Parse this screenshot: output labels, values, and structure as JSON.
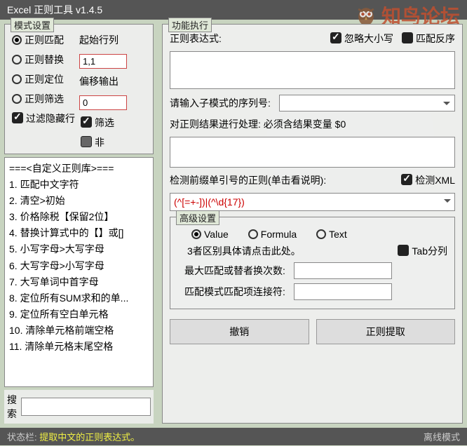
{
  "title": "Excel 正则工具 v1.4.5",
  "watermark": "知鸟论坛",
  "modeGroup": {
    "title": "模式设置",
    "radios": [
      "正则匹配",
      "正则替换",
      "正则定位",
      "正则筛选"
    ],
    "selected": 0,
    "hideRow": "过滤隐藏行",
    "startLabel": "起始行列",
    "startValue": "1,1",
    "offsetLabel": "偏移输出",
    "offsetValue": "0",
    "filter": "筛选",
    "not": "非"
  },
  "library": {
    "header": "===<自定义正则库>===",
    "items": [
      "1. 匹配中文字符",
      "2. 清空>初始",
      "3. 价格除税【保留2位】",
      "4. 替换计算式中的【】或[]",
      "5. 小写字母>大写字母",
      "6. 大写字母>小写字母",
      "7. 大写单词中首字母",
      "8. 定位所有SUM求和的单...",
      "9. 定位所有空白单元格",
      "10. 清除单元格前端空格",
      "11. 清除单元格末尾空格"
    ]
  },
  "searchLabel": "搜索",
  "exec": {
    "title": "功能执行",
    "exprLabel": "正则表达式:",
    "ignoreCase": "忽略大小写",
    "reverse": "匹配反序",
    "subLabel": "请输入子模式的序列号:",
    "procLabel": "对正则结果进行处理:  必须含结果变量 $0",
    "prefixLabel": "检测前缀单引号的正则(单击看说明):",
    "xmlLabel": "检测XML",
    "prefixValue": "(^[=+-])|(^\\d{17})"
  },
  "adv": {
    "title": "高级设置",
    "radios": [
      "Value",
      "Formula",
      "Text"
    ],
    "selected": 0,
    "hint": "3者区别具体请点击此处。",
    "tab": "Tab分列",
    "maxLabel": "最大匹配或替者换次数:",
    "joinLabel": "匹配模式匹配项连接符:"
  },
  "buttons": {
    "undo": "撤销",
    "extract": "正则提取"
  },
  "status": {
    "label": "状态栏:",
    "msg": "提取中文的正则表达式。",
    "mode": "离线模式"
  }
}
